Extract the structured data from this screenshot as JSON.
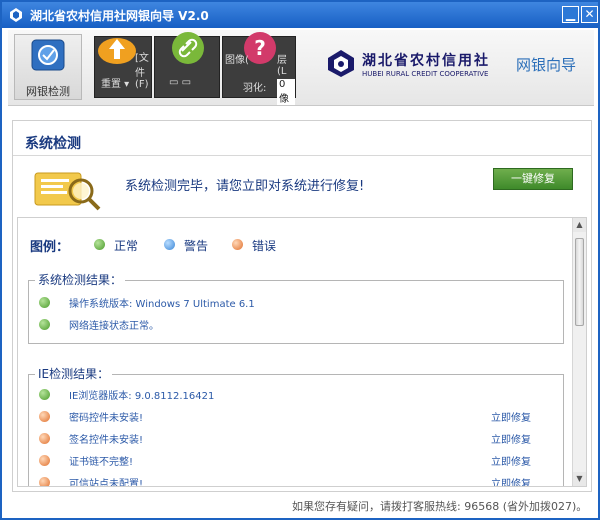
{
  "window": {
    "title": "湖北省农村信用社网银向导 V2.0",
    "minimize": "▁",
    "close": "✕"
  },
  "toolbar": {
    "main_label": "网银检测",
    "dark1_text": "[文件(F)",
    "dark1_sub": "重置 ▾",
    "dark2_text": "▭ ▭",
    "dark3_text_top": "图像(",
    "dark3_text_right": "层(L",
    "dark3_sub": "羽化:",
    "dark3_sub2": "0 像"
  },
  "logo": {
    "name_cn": "湖北省农村信用社",
    "name_en": "HUBEI RURAL CREDIT   COOPERATIVE",
    "tagline": "网银向导"
  },
  "diagnostic": {
    "section_title": "系统检测",
    "message": "系统检测完毕，请您立即对系统进行修复!",
    "repair_button": "一键修复"
  },
  "legend": {
    "title": "图例：",
    "items": [
      {
        "label": "正常",
        "status": "ok"
      },
      {
        "label": "警告",
        "status": "warn"
      },
      {
        "label": "错误",
        "status": "err"
      }
    ]
  },
  "system_results": {
    "title": "系统检测结果：",
    "rows": [
      {
        "status": "ok",
        "text": "操作系统版本: Windows 7 Ultimate 6.1",
        "action": ""
      },
      {
        "status": "ok",
        "text": "网络连接状态正常。",
        "action": ""
      }
    ]
  },
  "ie_results": {
    "title": "IE检测结果：",
    "rows": [
      {
        "status": "ok",
        "text": "IE浏览器版本: 9.0.8112.16421",
        "action": ""
      },
      {
        "status": "err",
        "text": "密码控件未安装!",
        "action": "立即修复"
      },
      {
        "status": "err",
        "text": "签名控件未安装!",
        "action": "立即修复"
      },
      {
        "status": "err",
        "text": "证书链不完整!",
        "action": "立即修复"
      },
      {
        "status": "err",
        "text": "可信站点未配置!",
        "action": "立即修复"
      }
    ]
  },
  "footer": {
    "text": "如果您存有疑问，请拨打客服热线: 96568 (省外加拨027)。"
  },
  "colors": {
    "title_bar": "#1d63c2",
    "accent_blue": "#1a3a80",
    "ok": "#4a9b2a",
    "warn": "#3a86d6",
    "err": "#e06f2c",
    "repair_green": "#3e8a2a"
  }
}
